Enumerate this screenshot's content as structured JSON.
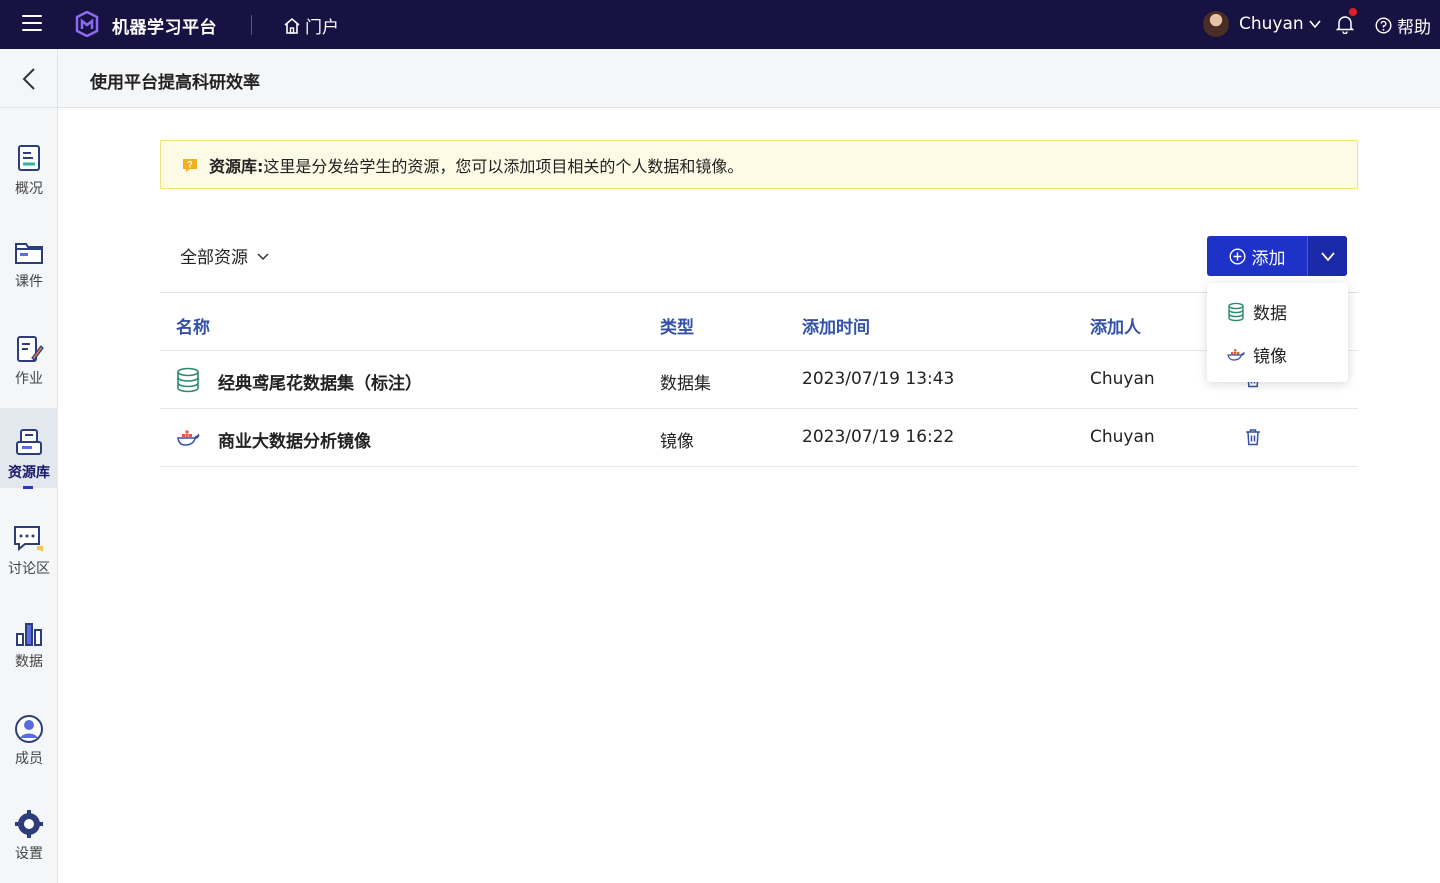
{
  "topbar": {
    "app_title": "机器学习平台",
    "portal_label": "门户",
    "user_name": "Chuyan",
    "help_label": "帮助",
    "brand_color": "#171241",
    "notification_dot_color": "#e02020"
  },
  "course": {
    "title": "使用平台提高科研效率"
  },
  "sidebar": {
    "items": [
      {
        "label": "概况",
        "icon": "overview-icon"
      },
      {
        "label": "课件",
        "icon": "folder-icon"
      },
      {
        "label": "作业",
        "icon": "homework-icon"
      },
      {
        "label": "资源库",
        "icon": "resource-icon",
        "active": true
      },
      {
        "label": "讨论区",
        "icon": "discussion-icon"
      },
      {
        "label": "数据",
        "icon": "bar-chart-icon"
      },
      {
        "label": "成员",
        "icon": "user-icon"
      },
      {
        "label": "设置",
        "icon": "gear-icon"
      }
    ]
  },
  "notice": {
    "title": "资源库:",
    "text": "这里是分发给学生的资源，您可以添加项目相关的个人数据和镜像。"
  },
  "filter": {
    "label": "全部资源"
  },
  "add_button": {
    "label": "添加",
    "color": "#1e32c8"
  },
  "dropdown": {
    "items": [
      {
        "label": "数据",
        "icon": "database-icon"
      },
      {
        "label": "镜像",
        "icon": "docker-icon"
      }
    ]
  },
  "table": {
    "columns": [
      "名称",
      "类型",
      "添加时间",
      "添加人"
    ],
    "rows": [
      {
        "name": "经典鸢尾花数据集（标注）",
        "type": "数据集",
        "time": "2023/07/19 13:43",
        "owner": "Chuyan",
        "icon": "database-icon"
      },
      {
        "name": "商业大数据分析镜像",
        "type": "镜像",
        "time": "2023/07/19 16:22",
        "owner": "Chuyan",
        "icon": "docker-icon"
      }
    ]
  }
}
